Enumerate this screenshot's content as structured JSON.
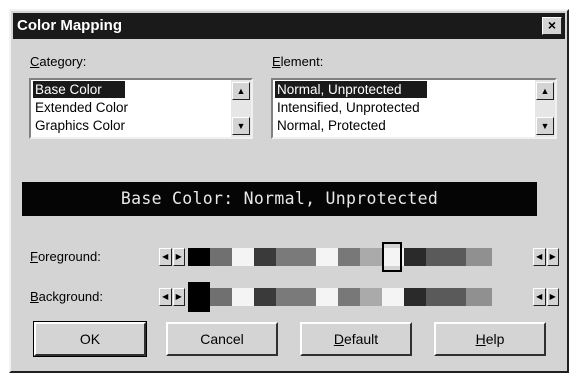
{
  "window": {
    "title": "Color Mapping",
    "close_glyph": "×"
  },
  "category": {
    "label_key": "C",
    "label_rest": "ategory:",
    "items": [
      "Base Color",
      "Extended Color",
      "Graphics Color"
    ],
    "selected_index": 0
  },
  "element": {
    "label_key": "E",
    "label_rest": "lement:",
    "items": [
      "Normal, Unprotected",
      "Intensified, Unprotected",
      "Normal, Protected"
    ],
    "selected_index": 0
  },
  "preview_text": "Base Color: Normal, Unprotected",
  "foreground": {
    "label_key": "F",
    "label_rest": "oreground:"
  },
  "background": {
    "label_key": "B",
    "label_rest": "ackground:"
  },
  "palette": [
    "#000000",
    "#707070",
    "#f4f4f4",
    "#3a3a3a",
    "#7a7a7a",
    "#f4f4f4",
    "#787878",
    "#aaaaaa",
    "#f4f4f4",
    "#2a2a2a",
    "#5a5a5a",
    "#909090"
  ],
  "buttons": {
    "ok": "OK",
    "cancel": "Cancel",
    "default_key": "D",
    "default_rest": "efault",
    "help_key": "H",
    "help_rest": "elp"
  }
}
